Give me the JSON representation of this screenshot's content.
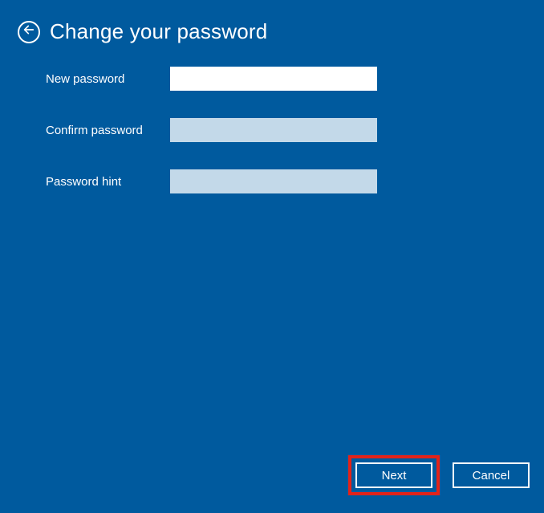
{
  "header": {
    "title": "Change your password"
  },
  "form": {
    "new_password": {
      "label": "New password",
      "value": ""
    },
    "confirm_password": {
      "label": "Confirm password",
      "value": ""
    },
    "password_hint": {
      "label": "Password hint",
      "value": ""
    }
  },
  "footer": {
    "next_label": "Next",
    "cancel_label": "Cancel"
  }
}
